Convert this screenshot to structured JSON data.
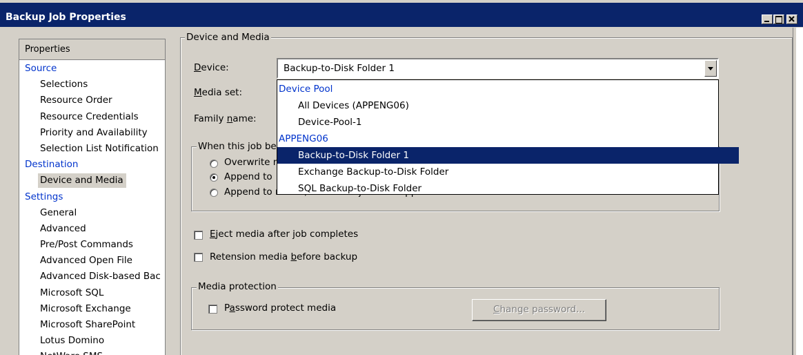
{
  "window": {
    "title": "Backup Job Properties"
  },
  "left_panel": {
    "header": "Properties",
    "items": [
      {
        "label": "Source",
        "type": "category"
      },
      {
        "label": "Selections",
        "type": "sub"
      },
      {
        "label": "Resource Order",
        "type": "sub"
      },
      {
        "label": "Resource Credentials",
        "type": "sub"
      },
      {
        "label": "Priority and Availability",
        "type": "sub"
      },
      {
        "label": "Selection List Notification",
        "type": "sub"
      },
      {
        "label": "Destination",
        "type": "category"
      },
      {
        "label": "Device and Media",
        "type": "sub",
        "selected": true
      },
      {
        "label": "Settings",
        "type": "category"
      },
      {
        "label": "General",
        "type": "sub"
      },
      {
        "label": "Advanced",
        "type": "sub"
      },
      {
        "label": "Pre/Post Commands",
        "type": "sub"
      },
      {
        "label": "Advanced Open File",
        "type": "sub"
      },
      {
        "label": "Advanced Disk-based Bac",
        "type": "sub"
      },
      {
        "label": "Microsoft SQL",
        "type": "sub"
      },
      {
        "label": "Microsoft Exchange",
        "type": "sub"
      },
      {
        "label": "Microsoft SharePoint",
        "type": "sub"
      },
      {
        "label": "Lotus Domino",
        "type": "sub"
      },
      {
        "label": "NetWare SMS",
        "type": "sub"
      }
    ]
  },
  "device_media": {
    "group_label": "Device and Media",
    "device_label_underlined": "D",
    "device_label_rest": "evice:",
    "device_value": "Backup-to-Disk Folder 1",
    "media_set_label_underlined": "M",
    "media_set_label_rest": "edia set:",
    "family_name_label_pre": "Family ",
    "family_name_label_underlined": "n",
    "family_name_label_rest": "ame:",
    "dropdown": [
      {
        "label": "Device Pool",
        "kind": "header"
      },
      {
        "label": "All Devices (APPENG06)",
        "kind": "option"
      },
      {
        "label": "Device-Pool-1",
        "kind": "option"
      },
      {
        "label": "APPENG06",
        "kind": "header"
      },
      {
        "label": "Backup-to-Disk Folder 1",
        "kind": "option",
        "selected": true
      },
      {
        "label": "Exchange Backup-to-Disk Folder",
        "kind": "option"
      },
      {
        "label": "SQL Backup-to-Disk Folder",
        "kind": "option"
      }
    ]
  },
  "when_job_begins": {
    "group_label": "When this job be",
    "overwrite_label": "Overwrite n",
    "append_label": "Append to",
    "append_terminate_label": "Append to media, terminate job if no appendable media is available",
    "selected": "append"
  },
  "options": {
    "eject_underlined": "E",
    "eject_rest": "ject media after job completes",
    "eject_checked": false,
    "retension_pre": "Retension media ",
    "retension_underlined": "b",
    "retension_rest": "efore backup",
    "retension_checked": false
  },
  "media_protection": {
    "group_label": "Media protection",
    "password_pre": "P",
    "password_underlined": "a",
    "password_rest": "ssword protect media",
    "password_checked": false,
    "change_password_underlined": "C",
    "change_password_rest": "hange password...",
    "change_password_enabled": false
  }
}
